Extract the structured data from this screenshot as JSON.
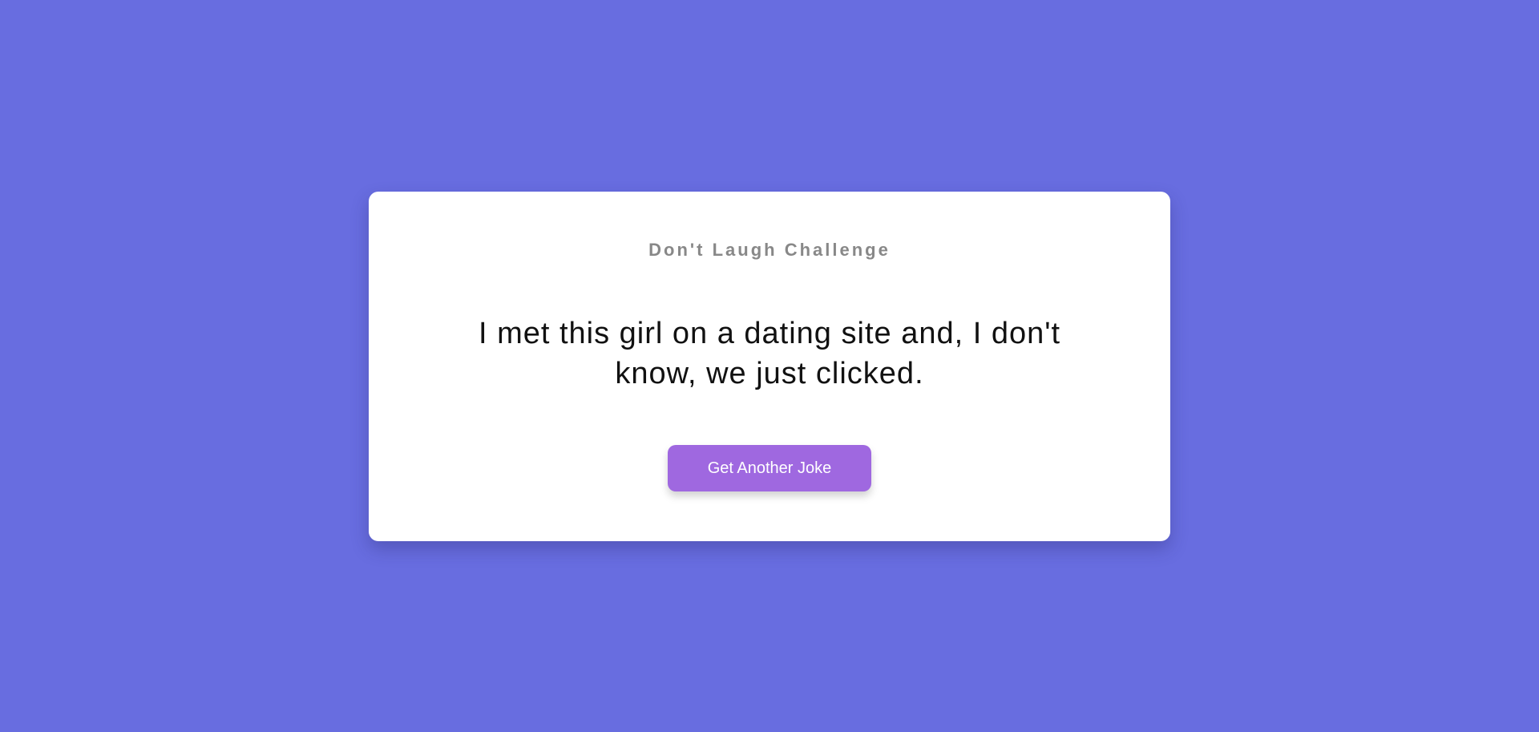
{
  "header": {
    "title": "Don't Laugh Challenge"
  },
  "joke": {
    "text": "I met this girl on a dating site and, I don't know, we just clicked."
  },
  "actions": {
    "next_joke_label": "Get Another Joke"
  },
  "colors": {
    "background": "#686de0",
    "card": "#ffffff",
    "accent": "#9f68e0",
    "title": "#888888",
    "text": "#111111"
  }
}
